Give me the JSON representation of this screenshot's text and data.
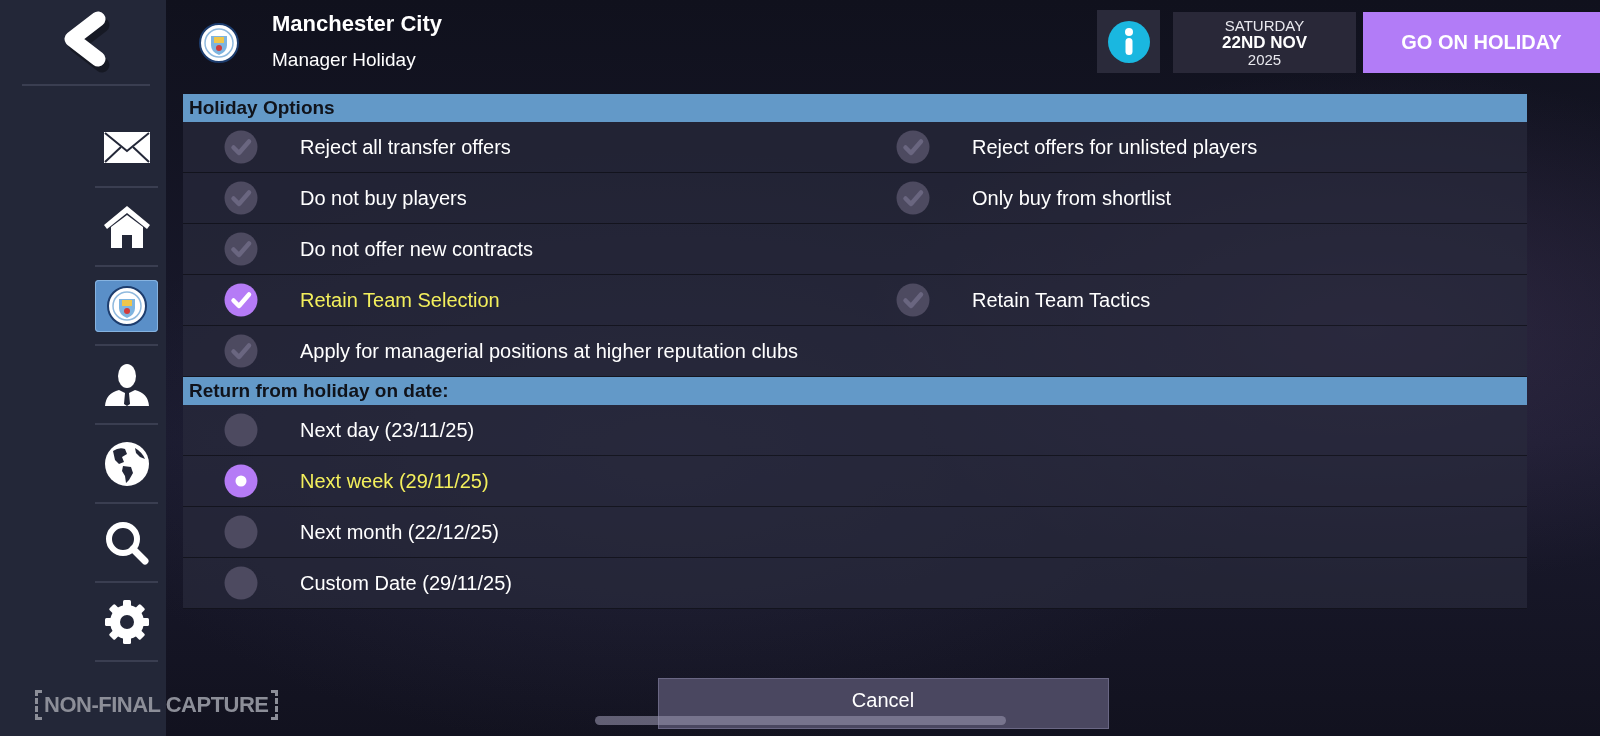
{
  "sidebar": {
    "items": [
      {
        "kind": "mail",
        "selected": false
      },
      {
        "kind": "home",
        "selected": false
      },
      {
        "kind": "club",
        "selected": true
      },
      {
        "kind": "manager",
        "selected": false
      },
      {
        "kind": "globe",
        "selected": false
      },
      {
        "kind": "search",
        "selected": false
      },
      {
        "kind": "settings",
        "selected": false
      }
    ]
  },
  "header": {
    "title": "Manchester City",
    "subtitle": "Manager Holiday"
  },
  "date": {
    "weekday": "SATURDAY",
    "day": "22ND NOV",
    "year": "2025"
  },
  "confirm_button": "GO ON HOLIDAY",
  "sections": [
    {
      "title": "Holiday Options",
      "kind": "checklist",
      "rows": [
        [
          {
            "label": "Reject all transfer offers",
            "checked": false
          },
          {
            "label": "Reject offers for unlisted players",
            "checked": false
          }
        ],
        [
          {
            "label": "Do not buy players",
            "checked": false
          },
          {
            "label": "Only buy from shortlist",
            "checked": false
          }
        ],
        [
          {
            "label": "Do not offer new contracts",
            "checked": false
          }
        ],
        [
          {
            "label": "Retain Team Selection",
            "checked": true
          },
          {
            "label": "Retain Team Tactics",
            "checked": false
          }
        ],
        [
          {
            "label": "Apply for managerial positions at higher reputation clubs",
            "checked": false
          }
        ]
      ]
    },
    {
      "title": "Return from holiday on date:",
      "kind": "radio",
      "options": [
        {
          "label": "Next day (23/11/25)",
          "selected": false
        },
        {
          "label": "Next week (29/11/25)",
          "selected": true
        },
        {
          "label": "Next month (22/12/25)",
          "selected": false
        },
        {
          "label": "Custom Date (29/11/25)",
          "selected": false
        }
      ]
    }
  ],
  "cancel_button": "Cancel",
  "capture_stamp": "NON-FINAL CAPTURE"
}
